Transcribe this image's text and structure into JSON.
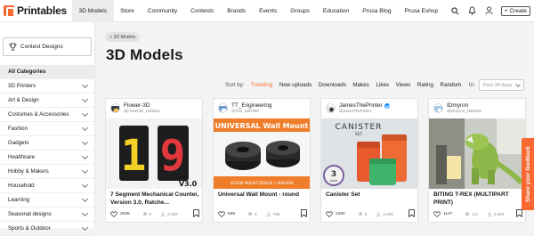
{
  "header": {
    "logo": "Printables",
    "nav": [
      "3D Models",
      "Store",
      "Community",
      "Contests",
      "Brands",
      "Events",
      "Groups",
      "Education",
      "Prusa Blog",
      "Prusa Eshop"
    ],
    "create_label": "+ Create",
    "icons": [
      "search-icon",
      "bell-icon",
      "user-icon"
    ]
  },
  "sidebar": {
    "contest_label": "Contest Designs",
    "categories_header": "All Categories",
    "categories": [
      "3D Printers",
      "Art & Design",
      "Costumes & Accessories",
      "Fashion",
      "Gadgets",
      "Healthcare",
      "Hobby & Makers",
      "Household",
      "Learning",
      "Seasonal designs",
      "Sports & Outdoor"
    ]
  },
  "main": {
    "breadcrumb": "< 3D Models",
    "title": "3D Models",
    "sort_label": "Sort by:",
    "sort_options": [
      "Trending",
      "New uploads",
      "Downloads",
      "Makes",
      "Likes",
      "Views",
      "Rating",
      "Random"
    ],
    "active_sort": "Trending",
    "in_label": "In:",
    "period_placeholder": "Past 30 days"
  },
  "cards": [
    {
      "author": "Flower-3D",
      "handle": "@Flower3D_1945812",
      "title": "7 Segment Mechanical Counter, Version 3.0, Ratche...",
      "likes": "2036",
      "downloads": "5",
      "views": "2,333",
      "verified": false
    },
    {
      "author": "TT_Engineering",
      "handle": "@Tom_1367080",
      "title": "Universal Wall Mount - round",
      "likes": "828",
      "downloads": "6",
      "views": "799",
      "verified": false
    },
    {
      "author": "JamesThePrinter",
      "handle": "@JamesThePrinter",
      "title": "Canister Set",
      "likes": "1360",
      "downloads": "5",
      "views": "3,009",
      "verified": true
    },
    {
      "author": "IDmyron",
      "handle": "@IDmyron_1590416",
      "title": "BITING T-REX (MULTIPART PRINT)",
      "likes": "1147",
      "downloads": "4.9",
      "views": "2,680",
      "verified": false
    }
  ],
  "thumb_text": {
    "digit_a": "1",
    "digit_b": "9",
    "version": "V3.0",
    "mount_banner": "UNIVERSAL Wall Mount",
    "mount_sub": "SCREW MOUNT DESIGN • VERSION",
    "canister_word": "CANISTER",
    "canister_set": "SET",
    "canister_count": "3",
    "canister_sizes": "sizes"
  },
  "feedback_label": "Share your feedback",
  "colors": {
    "accent": "#fa6831",
    "verified": "#1e90ff"
  }
}
